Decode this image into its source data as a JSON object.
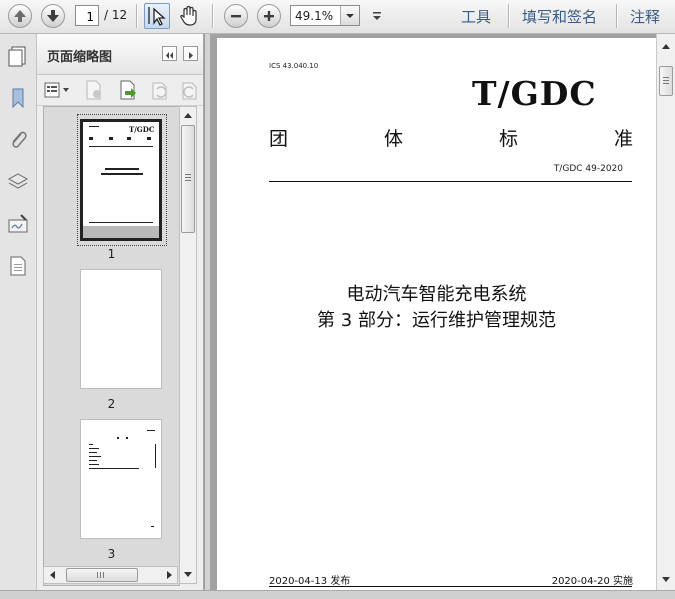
{
  "toolbar": {
    "page_current": "1",
    "page_total": "/ 12",
    "zoom": "49.1%",
    "menu": [
      "工具",
      "填写和签名",
      "注释"
    ]
  },
  "panel": {
    "title": "页面缩略图",
    "thumbnails": [
      "1",
      "2",
      "3"
    ]
  },
  "document": {
    "ics": "ICS 43.040.10",
    "org": "T/GDC",
    "std_type_chars": [
      "团",
      "体",
      "标",
      "准"
    ],
    "std_number": "T/GDC 49-2020",
    "title_line1": "电动汽车智能充电系统",
    "title_line2": "第 3 部分：运行维护管理规范",
    "publish": "2020-04-13 发布",
    "implement": "2020-04-20 实施"
  },
  "colors": {
    "menu_text": "#3a5b85",
    "select_tool_bg": "#c6d9ef"
  }
}
